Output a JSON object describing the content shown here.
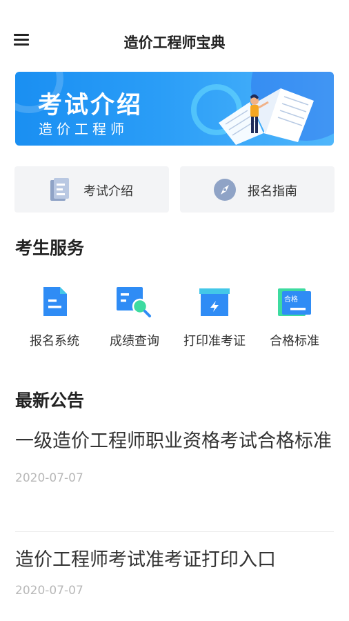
{
  "header": {
    "title": "造价工程师宝典"
  },
  "banner": {
    "title": "考试介绍",
    "subtitle": "造价工程师"
  },
  "quick_links": [
    {
      "label": "考试介绍",
      "icon": "document-icon"
    },
    {
      "label": "报名指南",
      "icon": "compass-icon"
    }
  ],
  "services": {
    "title": "考生服务",
    "items": [
      {
        "label": "报名系统",
        "icon": "form-icon"
      },
      {
        "label": "成绩查询",
        "icon": "score-search-icon"
      },
      {
        "label": "打印准考证",
        "icon": "print-icon"
      },
      {
        "label": "合格标准",
        "icon": "certificate-icon",
        "badge": "合格"
      }
    ]
  },
  "notices": {
    "title": "最新公告",
    "items": [
      {
        "title": "一级造价工程师职业资格考试合格标准",
        "date": "2020-07-07"
      },
      {
        "title": "造价工程师考试准考证打印入口",
        "date": "2020-07-07"
      }
    ]
  },
  "colors": {
    "accent": "#2f8cf5",
    "accent_light": "#43c7e8",
    "green": "#3ddba0",
    "grey_bg": "#f3f4f6"
  }
}
